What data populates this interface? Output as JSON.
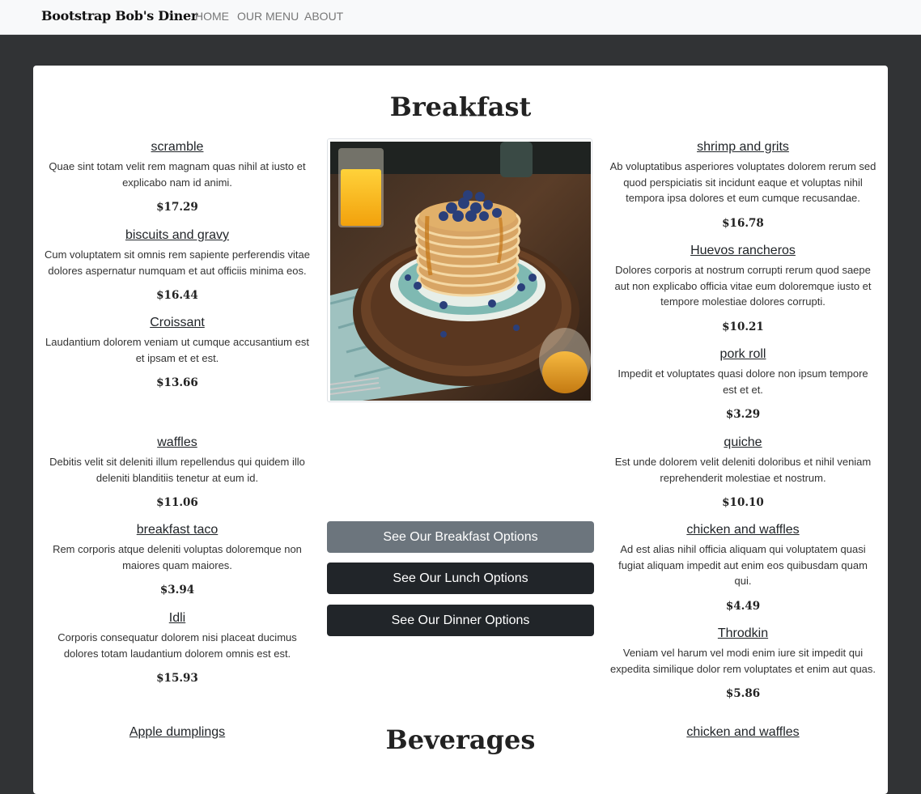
{
  "navbar": {
    "brand": "Bootstrap Bob's Diner",
    "links": [
      "HOME",
      "OUR MENU",
      "ABOUT"
    ]
  },
  "breakfast": {
    "title": "Breakfast",
    "left": [
      {
        "name": "scramble",
        "desc": "Quae sint totam velit rem magnam quas nihil at iusto et explicabo nam id animi.",
        "price": "$17.29"
      },
      {
        "name": "biscuits and gravy",
        "desc": "Cum voluptatem sit omnis rem sapiente perferendis vitae dolores aspernatur numquam et aut officiis minima eos.",
        "price": "$16.44"
      },
      {
        "name": "Croissant",
        "desc": "Laudantium dolorem veniam ut cumque accusantium est et ipsam et et est.",
        "price": "$13.66"
      },
      {
        "name": "waffles",
        "desc": "Debitis velit sit deleniti illum repellendus qui quidem illo deleniti blanditiis tenetur at eum id.",
        "price": "$11.06"
      },
      {
        "name": "breakfast taco",
        "desc": "Rem corporis atque deleniti voluptas doloremque non maiores quam maiores.",
        "price": "$3.94"
      },
      {
        "name": "Idli",
        "desc": "Corporis consequatur dolorem nisi placeat ducimus dolores totam laudantium dolorem omnis est est.",
        "price": "$15.93"
      }
    ],
    "right": [
      {
        "name": "shrimp and grits",
        "desc": "Ab voluptatibus asperiores voluptates dolorem rerum sed quod perspiciatis sit incidunt eaque et voluptas nihil tempora ipsa dolores et eum cumque recusandae.",
        "price": "$16.78"
      },
      {
        "name": "Huevos rancheros",
        "desc": "Dolores corporis at nostrum corrupti rerum quod saepe aut non explicabo officia vitae eum doloremque iusto et tempore molestiae dolores corrupti.",
        "price": "$10.21"
      },
      {
        "name": "pork roll",
        "desc": "Impedit et voluptates quasi dolore non ipsum tempore est et et.",
        "price": "$3.29"
      },
      {
        "name": "quiche",
        "desc": "Est unde dolorem velit deleniti doloribus et nihil veniam reprehenderit molestiae et nostrum.",
        "price": "$10.10"
      },
      {
        "name": "chicken and waffles",
        "desc": "Ad est alias nihil officia aliquam qui voluptatem quasi fugiat aliquam impedit aut enim eos quibusdam quam qui.",
        "price": "$4.49"
      },
      {
        "name": "Throdkin",
        "desc": "Veniam vel harum vel modi enim iure sit impedit qui expedita similique dolor rem voluptates et enim aut quas.",
        "price": "$5.86"
      }
    ]
  },
  "buttons": {
    "breakfast": "See Our Breakfast Options",
    "lunch": "See Our Lunch Options",
    "dinner": "See Our Dinner Options"
  },
  "beverages": {
    "title": "Beverages",
    "left_first": "Apple dumplings",
    "right_first": "chicken and waffles"
  },
  "colors": {
    "page_bg": "#313335",
    "navbar_bg": "#f8f9fa",
    "btn_secondary": "#6c757d",
    "btn_dark": "#212529"
  },
  "icons": {
    "photo": "pancake-stack-photo"
  }
}
